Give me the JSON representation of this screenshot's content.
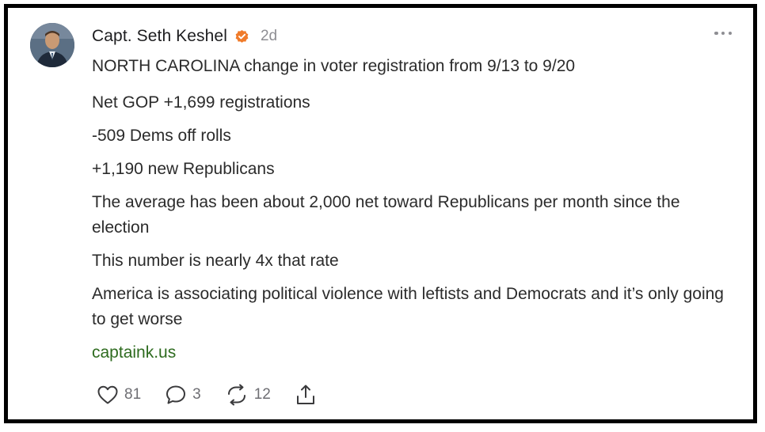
{
  "post": {
    "author": "Capt. Seth Keshel",
    "time": "2d",
    "paragraphs": [
      "NORTH CAROLINA change in voter registration from 9/13 to 9/20",
      "Net GOP +1,699 registrations",
      "-509 Dems off rolls",
      "+1,190 new Republicans",
      "The average has been about 2,000 net toward Republicans per month since the election",
      "This number is nearly 4x that rate",
      "America is associating political violence with leftists and Democrats and it’s only going to get worse"
    ],
    "link": "captaink.us"
  },
  "actions": {
    "likes": "81",
    "comments": "3",
    "restacks": "12"
  },
  "icons": {
    "verified": "verified-badge-icon",
    "more": "more-options-icon",
    "like": "heart-icon",
    "comment": "comment-bubble-icon",
    "restack": "restack-arrows-icon",
    "share": "share-icon"
  },
  "colors": {
    "verified_badge": "#f07b2a",
    "link": "#2e6b1f",
    "meta_gray": "#8e8e93",
    "frame_border": "#000000"
  }
}
